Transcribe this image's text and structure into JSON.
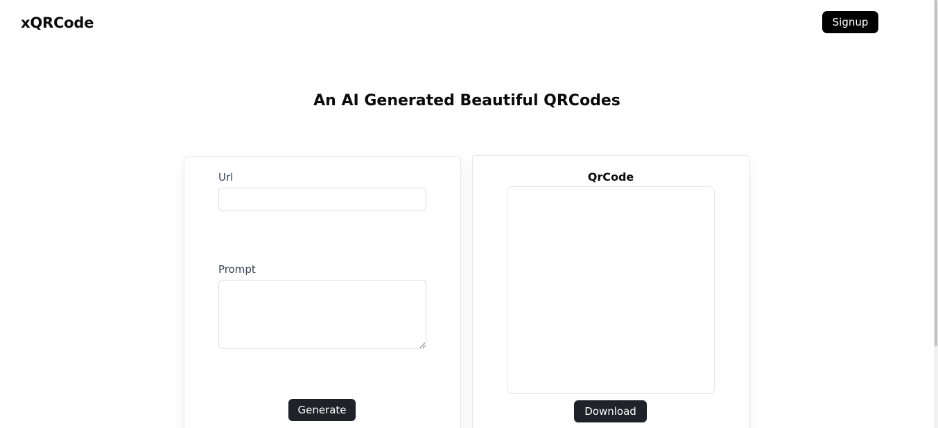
{
  "header": {
    "brand": "xQRCode",
    "signup_label": "Signup"
  },
  "hero": {
    "title": "An AI Generated Beautiful QRCodes"
  },
  "form": {
    "url_label": "Url",
    "url_value": "",
    "url_placeholder": "",
    "prompt_label": "Prompt",
    "prompt_value": "",
    "prompt_placeholder": "",
    "generate_label": "Generate"
  },
  "qr_panel": {
    "title": "QrCode",
    "download_label": "Download"
  },
  "colors": {
    "primary_button": "#000000",
    "dark_button": "#1f2329",
    "text": "#0b0b0b",
    "label": "#374151",
    "border": "#e5e7eb"
  }
}
